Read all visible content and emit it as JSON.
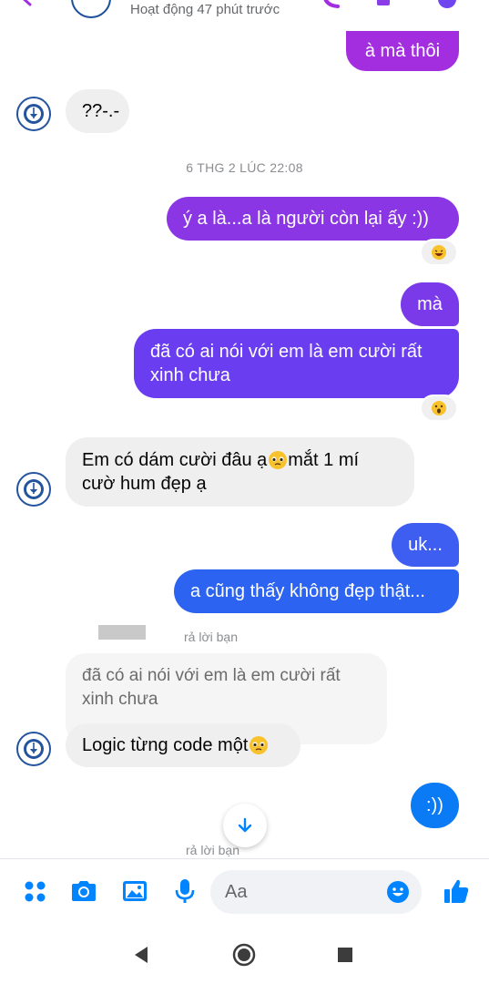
{
  "header": {
    "status": "Hoạt động 47 phút trước"
  },
  "messages": {
    "m1": "à mà thôi",
    "m2": "??-.-",
    "timestamp": "6 THG 2 LÚC 22:08",
    "m3": "ý a là...a là người còn lại ấy :))",
    "m4": "mà",
    "m5_line1": "đã có ai nói với em là em cười rất",
    "m5_line2": "xinh chưa",
    "m6_line1": "Em có dám cười đâu ạ",
    "m6_line1b": " mắt 1 mí",
    "m6_line2": "cườ hum đẹp ạ",
    "m7": "uk...",
    "m8": "a cũng thấy không đẹp thật...",
    "reply1_label": "rả lời bạn",
    "quoted_line1": "đã có ai nói với em là em cười rất",
    "quoted_line2": "xinh chưa",
    "m9": "Logic từng code một",
    "m10": ":))",
    "reply2_label": "rả lời bạn"
  },
  "reactions": {
    "r1": "laughing-emoji",
    "r2": "surprised-emoji"
  },
  "composer": {
    "placeholder": "Aa"
  },
  "colors": {
    "bubble_gradient_top": "#a32ee0",
    "bubble_gradient_mid": "#6a3df0",
    "bubble_gradient_bottom": "#2c6ff0",
    "messenger_blue": "#0084ff",
    "incoming_bg": "#efefef"
  }
}
